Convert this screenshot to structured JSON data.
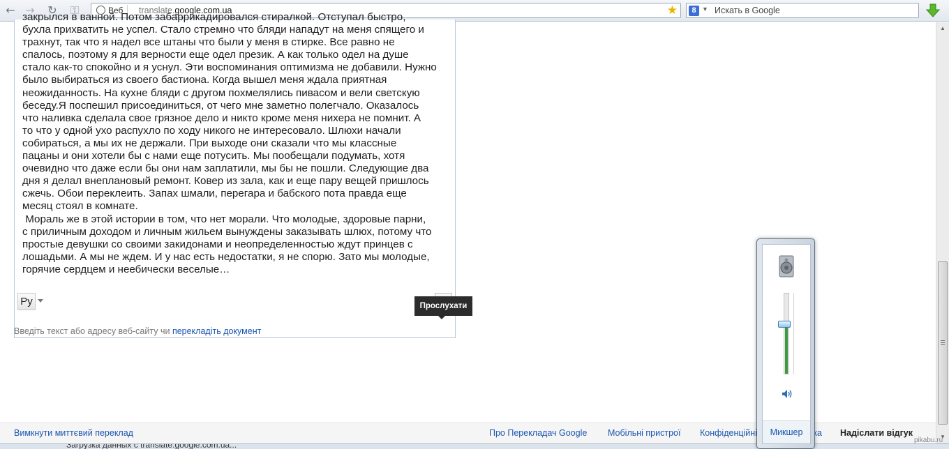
{
  "browser": {
    "url_chip_label": "Веб",
    "url_prefix": "translate.",
    "url_domain": "google.com.ua",
    "search_placeholder": "Искать в Google",
    "search_logo": "8"
  },
  "translator": {
    "text_lines": [
      "закрылся в ванной. Потом забаррикадировался стиралкой. Отступал быстро,",
      "бухла прихватить не успел. Стало стремно что бляди нападут на меня спящего и",
      "трахнут, так что я надел все штаны что были у меня в стирке. Все равно не",
      "спалось, поэтому я для верности еще одел презик. А как только одел на душе",
      "стало как-то спокойно и я уснул. Эти воспоминания оптимизма не добавили. Нужно",
      "было выбираться из своего бастиона. Когда вышел меня ждала приятная",
      "неожиданность. На кухне бляди с другом похмелялись пивасом и вели светскую",
      "беседу.Я поспешил присоединиться, от чего мне заметно полегчало. Оказалось",
      "что наливка сделала свое грязное дело и никто кроме меня нихера не помнит. А",
      "то что у одной ухо распухло по ходу никого не интересовало. Шлюхи начали",
      "собираться, а мы их не держали. При выходе они сказали что мы классные",
      "пацаны и они хотели бы с нами еще потусить. Мы пообещали подумать, хотя",
      "очевидно что даже если бы они нам заплатили, мы бы не пошли. Следующие два",
      "дня я делал внеплановый ремонт. Ковер из зала, как и еще пару вещей пришлось",
      "сжечь. Обои переклеить. Запах шмали, перегара и бабского пота правда еще",
      "месяц стоял в комнате.",
      " Мораль же в этой истории в том, что нет морали. Что молодые, здоровые парни,",
      "с приличным доходом и личным жильем вынуждены заказывать шлюх, потому что",
      "простые девушки со своими закидонами и неопределенностью ждут принцев с",
      "лошадьми. А мы не ждем. И у нас есть недостатки, я не спорю. Зато мы молодые,",
      "горячие сердцем и неебически веселые…"
    ],
    "lang_label": "Ру",
    "listen_tooltip": "Прослухати",
    "hint_text": "Введіть текст або адресу веб-сайту чи ",
    "hint_link": "перекладіть документ"
  },
  "footer": {
    "instant_off": "Вимкнути миттєвий переклад",
    "about": "Про Перекладач Google",
    "mobile": "Мобільні пристрої",
    "privacy": "Конфіденційність",
    "help": "Довідка",
    "feedback": "Надіслати відгук"
  },
  "status": {
    "text": "Загрузка данных с translate.google.com.ua..."
  },
  "volume_popup": {
    "mixer_label": "Микшер",
    "level": 0.36,
    "accent": "#3f9a3f"
  },
  "watermark": "pikabu.ru"
}
